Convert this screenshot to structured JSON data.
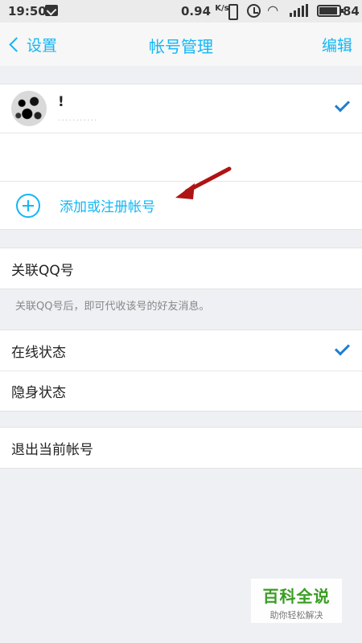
{
  "status_bar": {
    "time": "19:50",
    "speed": "0.94",
    "speed_unit": "K/s",
    "battery": "84",
    "icons": [
      "message-icon",
      "vibrate-icon",
      "alarm-icon",
      "wifi-icon",
      "signal-icon",
      "battery-icon"
    ]
  },
  "nav": {
    "back_label": "设置",
    "title": "帐号管理",
    "edit_label": "编辑"
  },
  "account": {
    "name": "!",
    "number_masked": "···········",
    "selected": true
  },
  "add_account": {
    "label": "添加或注册帐号"
  },
  "linked": {
    "label": "关联QQ号",
    "hint": "关联QQ号后，即可代收该号的好友消息。"
  },
  "status_options": [
    {
      "label": "在线状态",
      "selected": true
    },
    {
      "label": "隐身状态",
      "selected": false
    }
  ],
  "logout": {
    "label": "退出当前帐号"
  },
  "watermark": {
    "main": "百科全说",
    "sub": "助你轻松解决"
  },
  "colors": {
    "accent": "#12b7f5",
    "check": "#1e7fd1",
    "annotation_arrow": "#b01313",
    "watermark_green": "#3a9d23"
  }
}
